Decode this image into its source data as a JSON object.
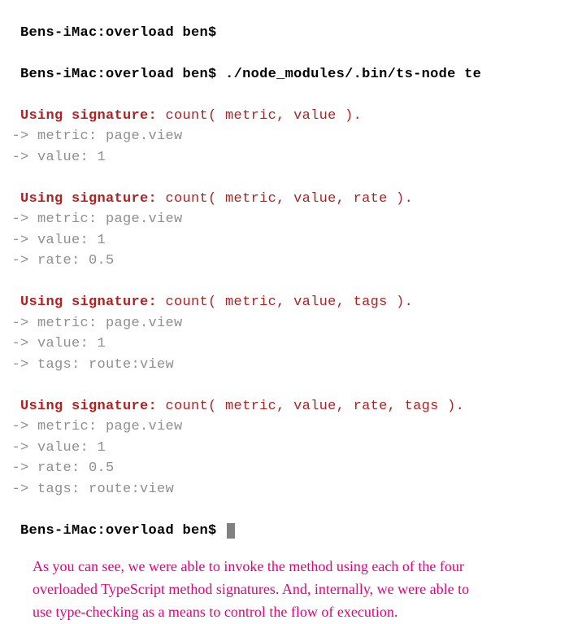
{
  "terminal": {
    "prompt": "Bens-iMac:overload ben$",
    "empty_cmd": " ",
    "run_cmd": " ./node_modules/.bin/ts-node te",
    "cursor_cmd": " ",
    "blocks": [
      {
        "label": "Using signature:",
        "signature": " count( metric, value ).",
        "details": [
          " -> metric: page.view",
          " -> value: 1"
        ]
      },
      {
        "label": "Using signature:",
        "signature": " count( metric, value, rate ).",
        "details": [
          " -> metric: page.view",
          " -> value: 1",
          " -> rate: 0.5"
        ]
      },
      {
        "label": "Using signature:",
        "signature": " count( metric, value, tags ).",
        "details": [
          " -> metric: page.view",
          " -> value: 1",
          " -> tags: route:view"
        ]
      },
      {
        "label": "Using signature:",
        "signature": " count( metric, value, rate, tags ).",
        "details": [
          " -> metric: page.view",
          " -> value: 1",
          " -> rate: 0.5",
          " -> tags: route:view"
        ]
      }
    ]
  },
  "annotation": {
    "part1": "As you can see, we were able to invoke the method using each of the four ",
    "em": "overloaded TypeScript method signatures",
    "part2": ". And, internally, we were able to use type-checking as a means to control the flow of execution."
  }
}
